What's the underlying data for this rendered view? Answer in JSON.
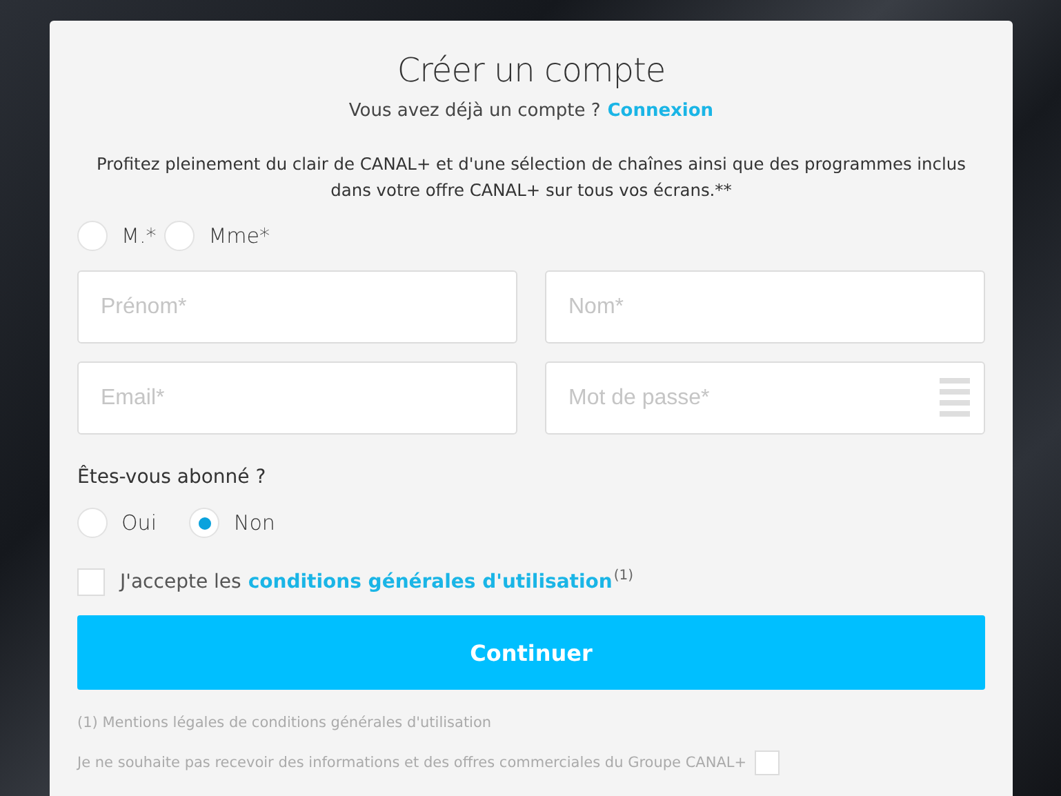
{
  "title": "Créer un compte",
  "login_prompt": {
    "text": "Vous avez déjà un compte ?",
    "link": "Connexion"
  },
  "intro": "Profitez pleinement du clair de CANAL+ et d'une sélection de chaînes ainsi que des programmes inclus dans votre offre CANAL+ sur tous vos écrans.**",
  "civility": [
    {
      "label": "M.*",
      "selected": false
    },
    {
      "label": "Mme*",
      "selected": false
    }
  ],
  "fields": [
    {
      "placeholder": "Prénom*",
      "kind": "text"
    },
    {
      "placeholder": "Nom*",
      "kind": "text"
    },
    {
      "placeholder": "Email*",
      "kind": "text"
    },
    {
      "placeholder": "Mot de passe*",
      "kind": "password"
    }
  ],
  "subscriber": {
    "question": "Êtes-vous abonné ?",
    "options": [
      {
        "label": "Oui",
        "selected": false
      },
      {
        "label": "Non",
        "selected": true
      }
    ]
  },
  "terms": {
    "checked": false,
    "text": "J'accepte les",
    "link": "conditions générales d'utilisation",
    "note": "(1)"
  },
  "submit": "Continuer",
  "footnote": "(1) Mentions légales de conditions générales d'utilisation",
  "optout": {
    "text": "Je ne souhaite pas recevoir des informations et des offres commerciales du Groupe CANAL+",
    "checked": false
  }
}
